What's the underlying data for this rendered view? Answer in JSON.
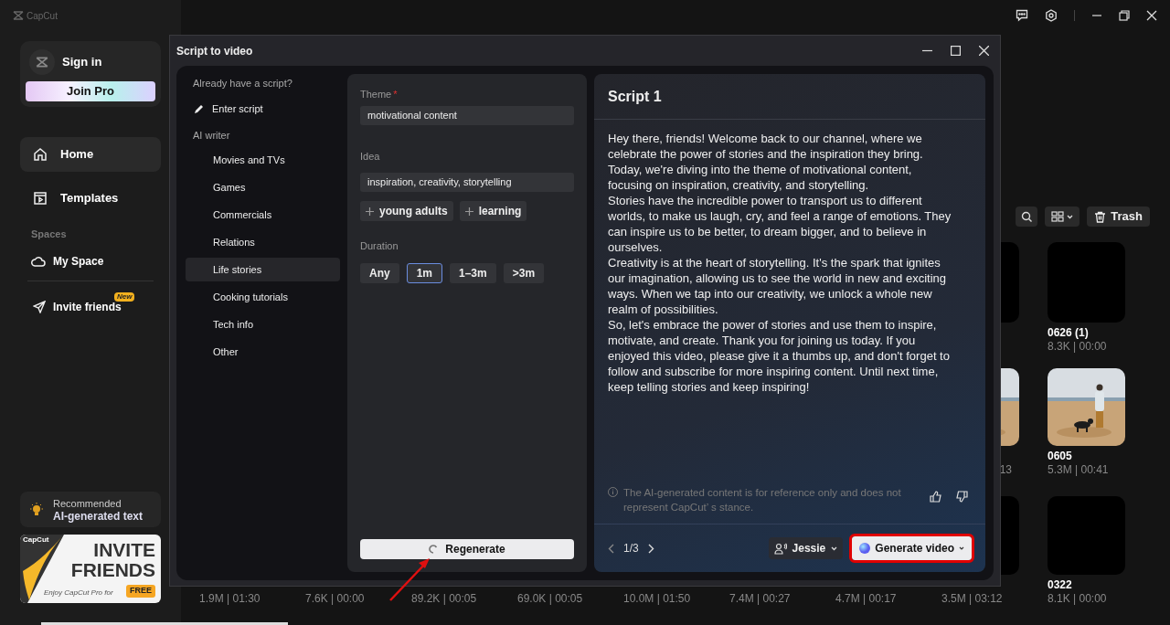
{
  "app": {
    "name": "CapCut"
  },
  "sidebar": {
    "sign_in": "Sign in",
    "join_pro": "Join Pro",
    "nav": [
      {
        "label": "Home",
        "selected": true
      },
      {
        "label": "Templates",
        "selected": false
      }
    ],
    "spaces_label": "Spaces",
    "spaces": [
      {
        "label": "My Space"
      }
    ],
    "invite": {
      "label": "Invite friends",
      "badge": "New"
    },
    "recommended": {
      "label": "Recommended",
      "title": "AI-generated text"
    },
    "banner": {
      "brand": "CapCut",
      "line1": "INVITE",
      "line2": "FRIENDS",
      "sub": "Enjoy CapCut Pro for",
      "tag": "FREE"
    }
  },
  "toolbar": {
    "trash": "Trash"
  },
  "grid": {
    "rows": [
      {
        "items": [
          {
            "kind": "video"
          },
          {
            "kind": "video",
            "name": "0626 (1)",
            "stats": "8.3K | 00:00"
          }
        ]
      },
      {
        "items": [
          {
            "stats": "13"
          },
          {
            "name": "0605",
            "stats": "5.3M | 00:41"
          }
        ]
      },
      {
        "items": [
          {
            "kind": "none",
            "stats": "1.9M | 01:30"
          },
          {
            "kind": "none",
            "stats": "7.6K | 00:00"
          },
          {
            "kind": "none",
            "stats": "89.2K | 00:05"
          },
          {
            "kind": "none",
            "stats": "69.0K | 00:05"
          },
          {
            "kind": "none",
            "stats": "10.0M | 01:50"
          },
          {
            "kind": "none",
            "stats": "7.4M | 00:27"
          },
          {
            "kind": "none",
            "stats": "4.7M | 00:17"
          },
          {
            "kind": "video",
            "stats": "3.5M | 03:12"
          },
          {
            "kind": "video",
            "name": "0322",
            "stats": "8.1K | 00:00"
          }
        ]
      }
    ]
  },
  "dialog": {
    "title": "Script to video",
    "nav": {
      "have_script": "Already have a script?",
      "enter_script": "Enter script",
      "ai_writer": "AI writer",
      "categories": [
        {
          "label": "Movies and TVs",
          "selected": false
        },
        {
          "label": "Games",
          "selected": false
        },
        {
          "label": "Commercials",
          "selected": false
        },
        {
          "label": "Relations",
          "selected": false
        },
        {
          "label": "Life stories",
          "selected": true
        },
        {
          "label": "Cooking tutorials",
          "selected": false
        },
        {
          "label": "Tech info",
          "selected": false
        },
        {
          "label": "Other",
          "selected": false
        }
      ]
    },
    "form": {
      "theme_label": "Theme",
      "theme_required": "*",
      "theme": "motivational content",
      "idea_label": "Idea",
      "idea": "inspiration, creativity, storytelling",
      "suggestions": [
        "young adults",
        "learning"
      ],
      "duration_label": "Duration",
      "durations": [
        {
          "label": "Any",
          "selected": false
        },
        {
          "label": "1m",
          "selected": true
        },
        {
          "label": "1–3m",
          "selected": false
        },
        {
          "label": ">3m",
          "selected": false
        }
      ],
      "regenerate": "Regenerate"
    },
    "script": {
      "title": "Script 1",
      "paragraphs": [
        "Hey there, friends! Welcome back to our channel, where we celebrate the power of stories and the inspiration they bring. Today, we're diving into the theme of motivational content, focusing on inspiration, creativity, and storytelling.",
        "Stories have the incredible power to transport us to different worlds, to make us laugh, cry, and feel a range of emotions. They can inspire us to be better, to dream bigger, and to believe in ourselves.",
        "Creativity is at the heart of storytelling. It's the spark that ignites our imagination, allowing us to see the world in new and exciting ways. When we tap into our creativity, we unlock a whole new realm of possibilities.",
        "So, let's embrace the power of stories and use them to inspire, motivate, and create. Thank you for joining us today. If you enjoyed this video, please give it a thumbs up, and don't forget to follow and subscribe for more inspiring content. Until next time, keep telling stories and keep inspiring!"
      ],
      "disclaimer": "The AI-generated content is for reference only and does not represent CapCut’ s stance.",
      "page": "1/3",
      "voice": "Jessie",
      "generate": "Generate video",
      "generate_highlighted": true
    }
  }
}
